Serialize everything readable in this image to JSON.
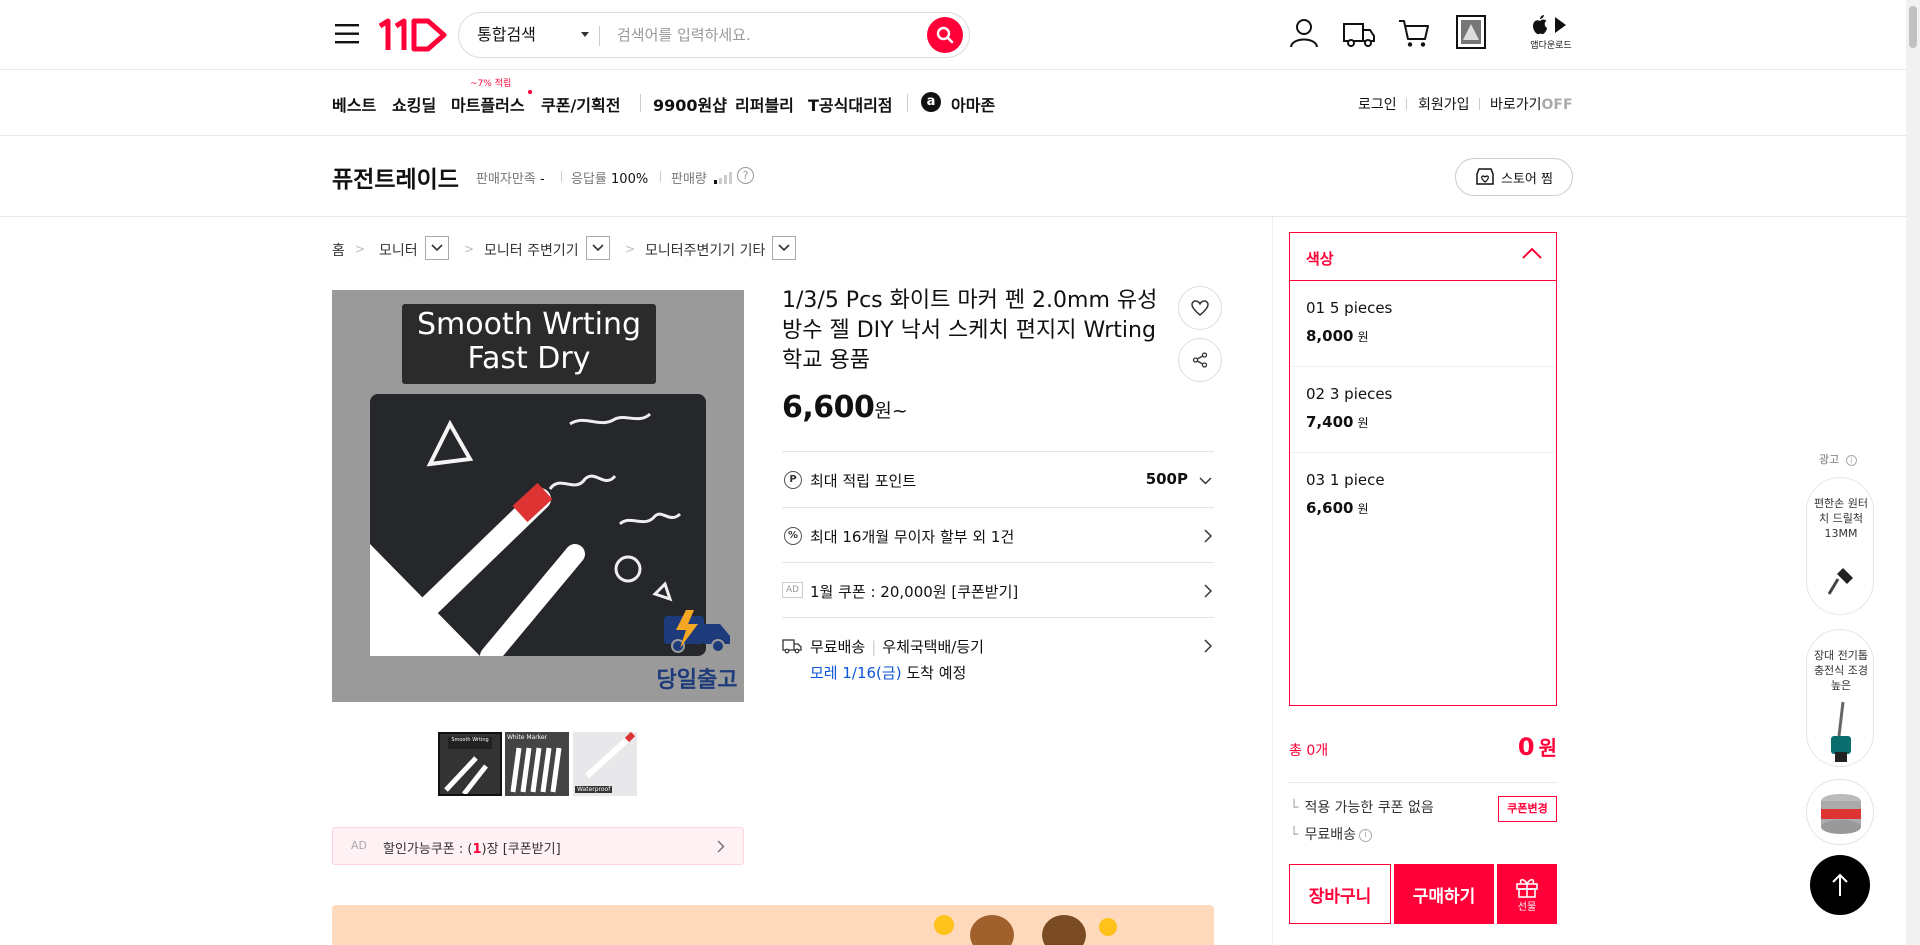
{
  "header": {
    "search_category": "통합검색",
    "search_placeholder": "검색어를 입력하세요.",
    "app_download_label": "앱다운로드"
  },
  "nav": {
    "items": [
      "베스트",
      "쇼킹딜",
      "마트플러스",
      "쿠폰/기획전",
      "9900원샵",
      "리퍼블리",
      "T공식대리점",
      "아마존"
    ],
    "mart_badge": "~7% 적립",
    "utility": [
      "로그인",
      "회원가입",
      "바로가기"
    ],
    "shortcut_state": "OFF"
  },
  "seller": {
    "name": "퓨전트레이드",
    "satisfaction_label": "판매자만족",
    "satisfaction_value": "-",
    "response_label": "응답률",
    "response_value": "100%",
    "sales_label": "판매량",
    "store_button": "스토어 찜"
  },
  "breadcrumb": [
    "홈",
    "모니터",
    "모니터 주변기기",
    "모니터주변기기 기타"
  ],
  "product": {
    "image_text_line1": "Smooth Wrting",
    "image_text_line2": "Fast Dry",
    "image_badge": "당일출고",
    "title": "1/3/5 Pcs 화이트 마커 펜 2.0mm 유성 방수 젤 DIY 낙서 스케치 편지지 Wrting 학교 용품",
    "price": "6,600",
    "price_unit": "원~",
    "thumb2_text": "White Marker",
    "thumb3_text": "Waterproof",
    "info_rows": [
      {
        "label": "최대 적립 포인트",
        "value": "500P"
      },
      {
        "label": "최대 16개월 무이자 할부 외 1건"
      },
      {
        "ad": "AD",
        "label": "1월 쿠폰 : 20,000원 [쿠폰받기]"
      },
      {
        "label": "무료배송",
        "label2": "우체국택배/등기",
        "arrival_date": "모레 1/16(금)",
        "arrival_suffix": " 도착 예정"
      }
    ],
    "coupon_strip": {
      "ad": "AD",
      "prefix": "할인가능쿠폰 : (",
      "count": "1",
      "suffix": ")장 [쿠폰받기]"
    }
  },
  "options": {
    "title": "색상",
    "items": [
      {
        "name": "01 5 pieces",
        "price": "8,000",
        "unit": "원"
      },
      {
        "name": "02 3 pieces",
        "price": "7,400",
        "unit": "원"
      },
      {
        "name": "03 1 piece",
        "price": "6,600",
        "unit": "원"
      }
    ]
  },
  "summary": {
    "total_label": "총 0개",
    "total_value": "0",
    "total_unit": "원",
    "coupon_none": "적용 가능한 쿠폰 없음",
    "coupon_change": "쿠폰변경",
    "free_shipping": "무료배송",
    "cart_button": "장바구니",
    "buy_button": "구매하기",
    "gift_button": "선물"
  },
  "side_ads": {
    "label": "광고",
    "items": [
      "편한손 원터치 드릴척 13MM",
      "장대 전기톱 충전식 조경 높은"
    ]
  },
  "colors": {
    "brand": "#ff0038",
    "blue": "#0b55d9"
  }
}
